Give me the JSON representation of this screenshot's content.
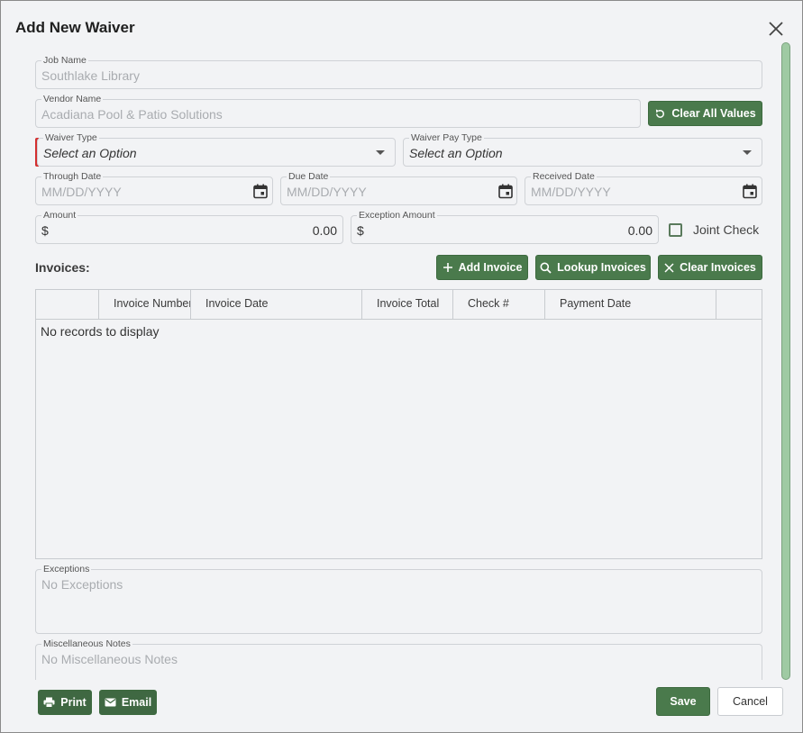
{
  "dialog": {
    "title": "Add New Waiver"
  },
  "job": {
    "label": "Job Name",
    "value": "Southlake Library"
  },
  "vendor": {
    "label": "Vendor Name",
    "value": "Acadiana Pool & Patio Solutions"
  },
  "clear_all_button": "Clear All Values",
  "waiver_type": {
    "label": "Waiver Type",
    "value": "Select an Option"
  },
  "waiver_pay_type": {
    "label": "Waiver Pay Type",
    "value": "Select an Option"
  },
  "through_date": {
    "label": "Through Date",
    "placeholder": "MM/DD/YYYY"
  },
  "due_date": {
    "label": "Due Date",
    "placeholder": "MM/DD/YYYY"
  },
  "received_date": {
    "label": "Received Date",
    "placeholder": "MM/DD/YYYY"
  },
  "amount": {
    "label": "Amount",
    "currency": "$",
    "value": "0.00"
  },
  "exception_amount": {
    "label": "Exception Amount",
    "currency": "$",
    "value": "0.00"
  },
  "joint_check": {
    "label": "Joint Check"
  },
  "invoices": {
    "label": "Invoices:",
    "add_button": "Add Invoice",
    "lookup_button": "Lookup Invoices",
    "clear_button": "Clear Invoices",
    "columns": [
      "",
      "Invoice Number",
      "Invoice Date",
      "Invoice Total",
      "Check #",
      "Payment Date",
      ""
    ],
    "empty_message": "No records to display"
  },
  "exceptions": {
    "label": "Exceptions",
    "placeholder": "No Exceptions"
  },
  "misc_notes": {
    "label": "Miscellaneous Notes",
    "placeholder": "No Miscellaneous Notes"
  },
  "footer": {
    "print_button": "Print",
    "email_button": "Email",
    "save_button": "Save",
    "cancel_button": "Cancel"
  },
  "colors": {
    "accent": "#4a7a4c",
    "required": "#d32f2f",
    "scrollbar": "#9fcaa3"
  }
}
